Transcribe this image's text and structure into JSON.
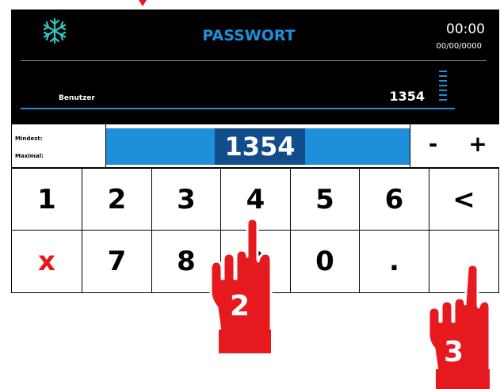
{
  "screen": {
    "title": "PASSWORT",
    "time": "00:00",
    "date": "00/00/0000",
    "user_label": "Benutzer",
    "user_value": "1354",
    "header_icon": "snowflake-icon"
  },
  "value_row": {
    "min_label": "Mindest:",
    "max_label": "Maximal:",
    "current_value": "1354",
    "minus_label": "-",
    "plus_label": "+"
  },
  "keypad": {
    "row1": [
      "1",
      "2",
      "3",
      "4",
      "5",
      "6",
      "<"
    ],
    "row2": [
      "x",
      "7",
      "8",
      "9",
      "0",
      ".",
      ""
    ]
  },
  "annotations": {
    "hand_2_label": "2",
    "hand_3_label": "3"
  },
  "colors": {
    "accent_blue": "#1e8fd8",
    "value_box_blue": "#114d8a",
    "cancel_red": "#e5191e",
    "hand_red": "#e5191e"
  }
}
